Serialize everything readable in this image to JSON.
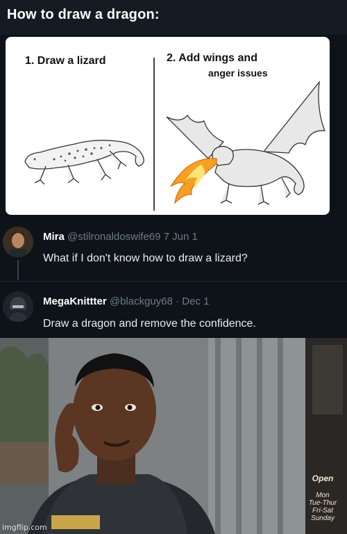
{
  "header": {
    "title": "How to draw a dragon:"
  },
  "card": {
    "step1_label": "1. Draw a lizard",
    "step2_title": "2. Add wings and",
    "step2_subtitle": "anger issues"
  },
  "tweets": [
    {
      "author": "Mira",
      "handle": "@stilronaldoswife69",
      "date": "7 Jun 1",
      "text": "What if I don't know how to draw a lizard?"
    },
    {
      "author": "MegaKnittter",
      "handle": "@blackguy68",
      "date": "· Dec 1",
      "text": "Draw a dragon and remove the confidence."
    }
  ],
  "photo": {
    "watermark": "imgflip.com",
    "sign_open": "Open",
    "sign_hours": "Mon\nTue-Thur\nFri-Sat\nSunday"
  },
  "colors": {
    "background": "#0d1319",
    "card": "#ffffff",
    "handle": "#6f7c89",
    "fire": "#f5a020"
  }
}
